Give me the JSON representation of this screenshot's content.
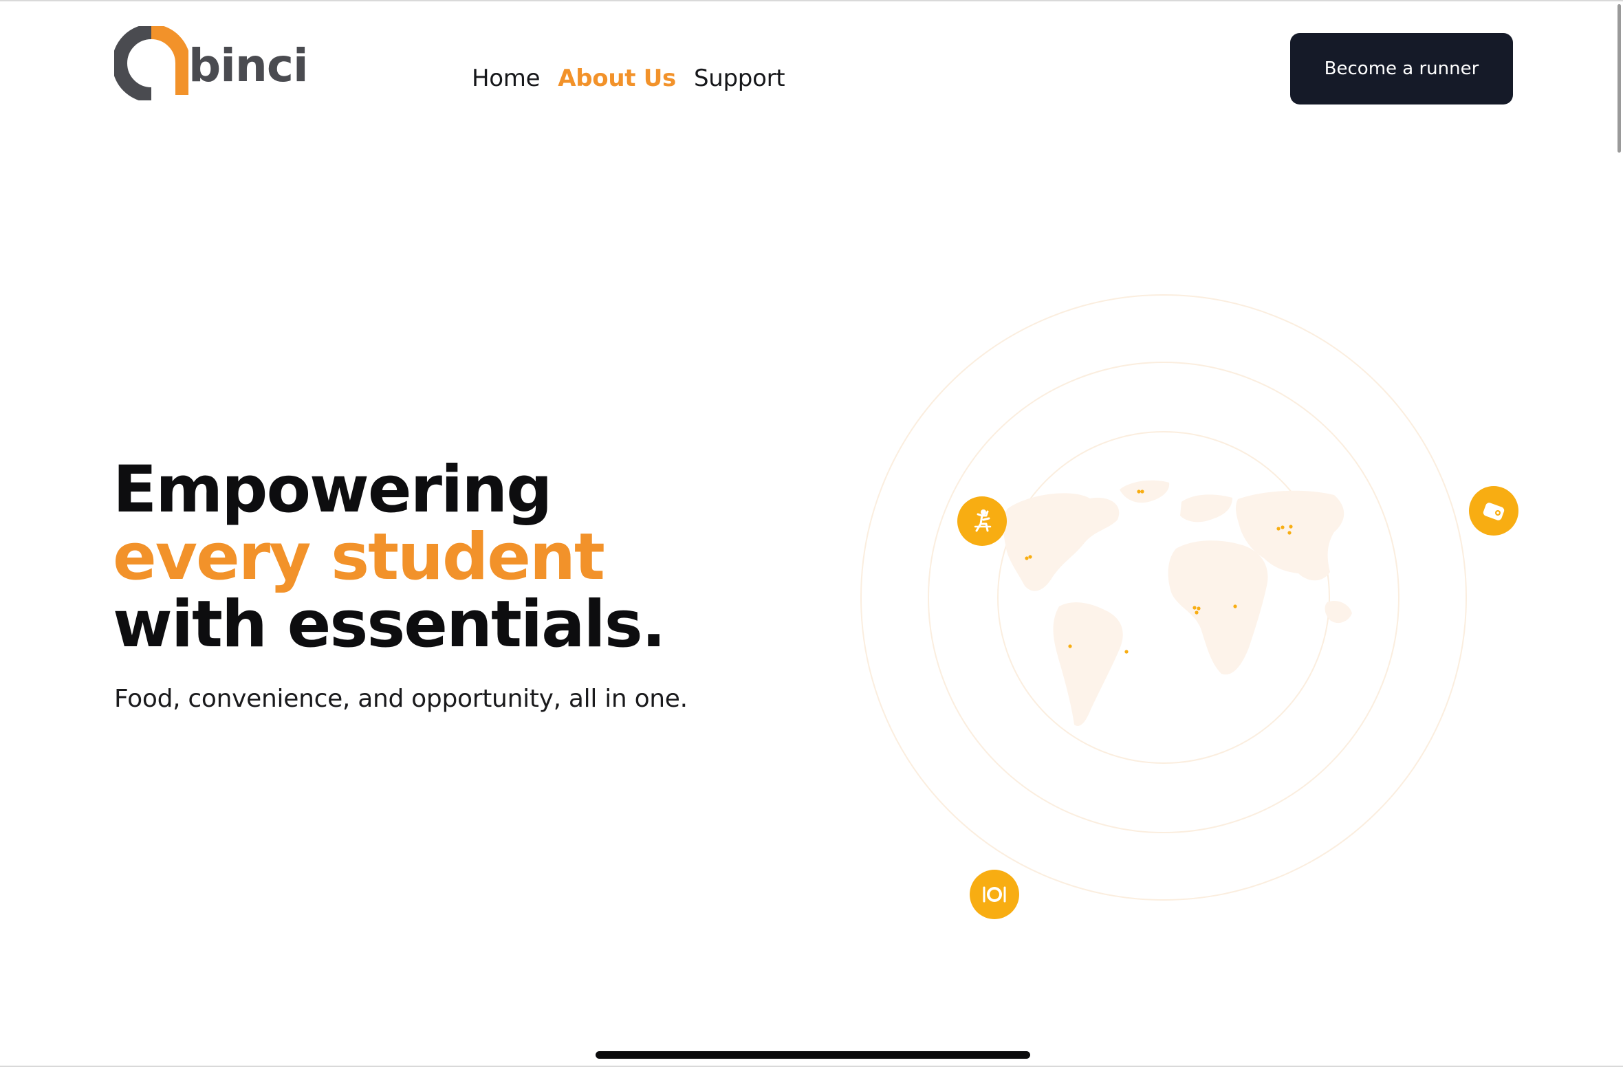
{
  "brand": {
    "name": "binci",
    "accent_color": "#f2922a",
    "dark_color": "#4a4b50",
    "icon": "binci-logo-mark"
  },
  "nav": {
    "items": [
      {
        "label": "Home",
        "active": false
      },
      {
        "label": "About Us",
        "active": true
      },
      {
        "label": "Support",
        "active": false
      }
    ],
    "active_color": "#f2922a"
  },
  "header": {
    "cta_label": "Become a runner",
    "cta_bg": "#151a28"
  },
  "hero": {
    "title_line1": "Empowering",
    "title_line2": "every student",
    "title_line3": "with essentials.",
    "subtitle": "Food, convenience, and opportunity, all in one."
  },
  "illustration": {
    "type": "world-map-with-orbits",
    "badge_color": "#f8ad12",
    "badges": [
      "relaxing-person-icon",
      "wallet-icon",
      "dining-plate-icon"
    ]
  }
}
